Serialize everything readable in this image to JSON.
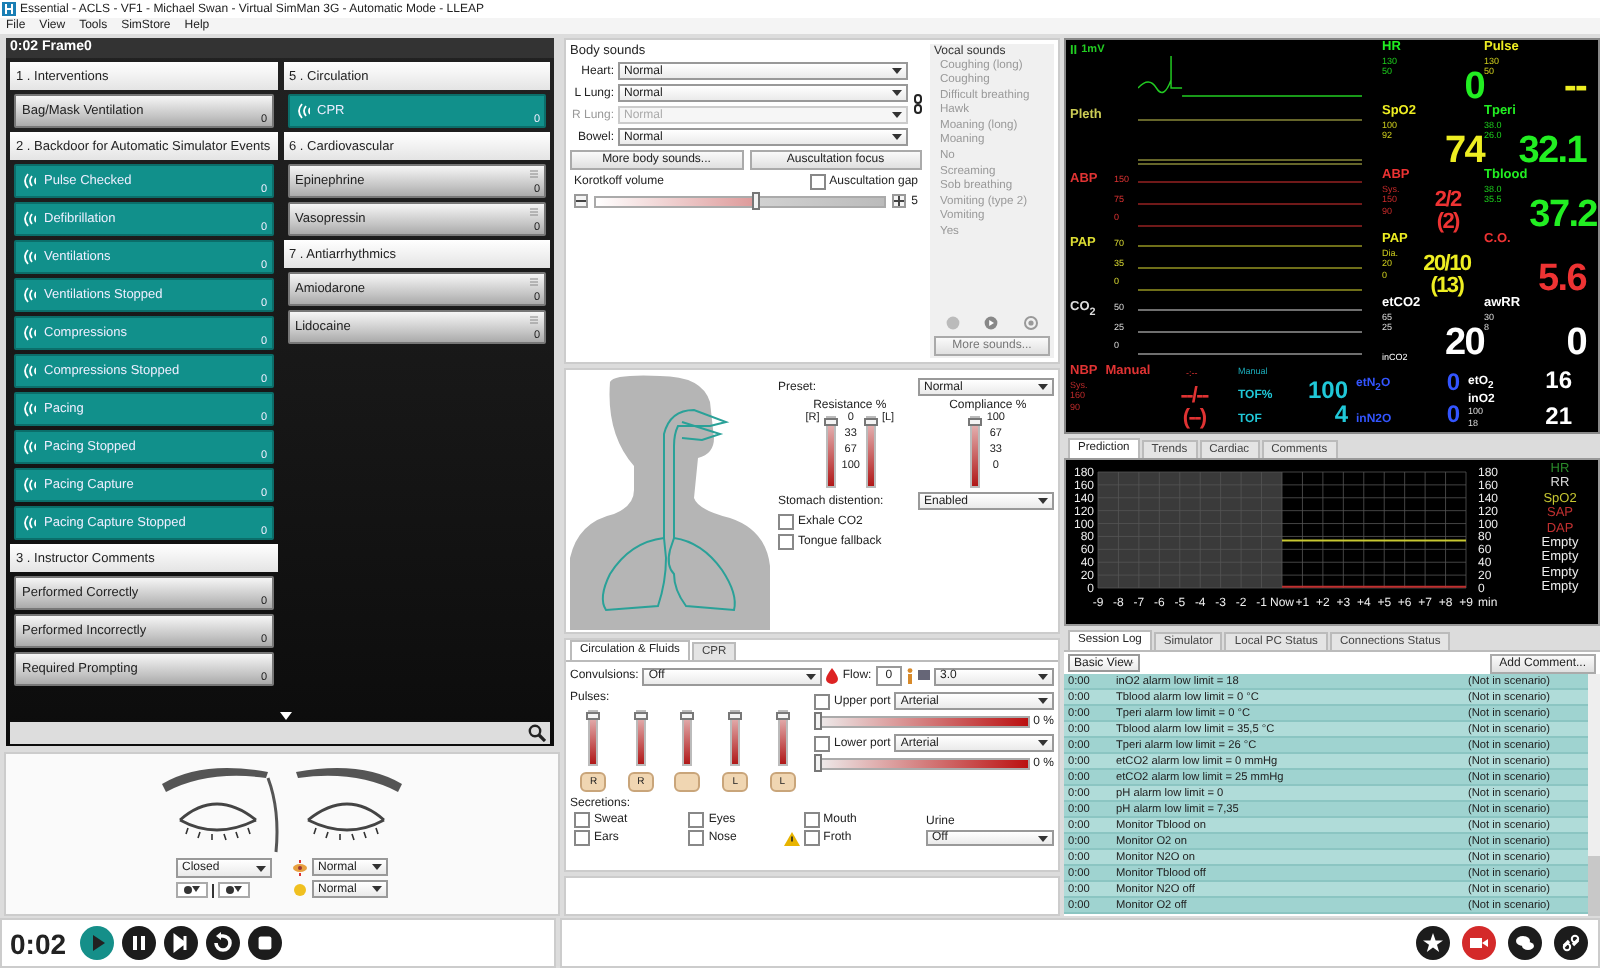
{
  "window": {
    "title": "Essential - ACLS - VF1 - Michael Swan - Virtual SimMan 3G - Automatic Mode - LLEAP"
  },
  "menu": [
    "File",
    "View",
    "Tools",
    "SimStore",
    "Help"
  ],
  "events_panel": {
    "header": "0:02 Frame0",
    "columns": [
      [
        {
          "title": "1 . Interventions",
          "items": [
            {
              "label": "Bag/Mask Ventilation",
              "count": "0",
              "kind": "button"
            }
          ]
        },
        {
          "title": "2 . Backdoor for Automatic Simulator Events",
          "items": [
            {
              "label": "Pulse Checked",
              "count": "0",
              "kind": "event"
            },
            {
              "label": "Defibrillation",
              "count": "0",
              "kind": "event"
            },
            {
              "label": "Ventilations",
              "count": "0",
              "kind": "event"
            },
            {
              "label": "Ventilations Stopped",
              "count": "0",
              "kind": "event"
            },
            {
              "label": "Compressions",
              "count": "0",
              "kind": "event"
            },
            {
              "label": "Compressions Stopped",
              "count": "0",
              "kind": "event"
            },
            {
              "label": "Pacing",
              "count": "0",
              "kind": "event"
            },
            {
              "label": "Pacing Stopped",
              "count": "0",
              "kind": "event"
            },
            {
              "label": "Pacing Capture",
              "count": "0",
              "kind": "event"
            },
            {
              "label": "Pacing Capture Stopped",
              "count": "0",
              "kind": "event"
            }
          ]
        },
        {
          "title": "3 . Instructor Comments",
          "items": [
            {
              "label": "Performed Correctly",
              "count": "0",
              "kind": "button"
            },
            {
              "label": "Performed Incorrectly",
              "count": "0",
              "kind": "button"
            },
            {
              "label": "Required Prompting",
              "count": "0",
              "kind": "button"
            }
          ]
        }
      ],
      [
        {
          "title": "5 . Circulation",
          "items": [
            {
              "label": "CPR",
              "count": "0",
              "kind": "event"
            }
          ]
        },
        {
          "title": "6 . Cardiovascular",
          "items": [
            {
              "label": "Epinephrine",
              "count": "0",
              "kind": "drug"
            },
            {
              "label": "Vasopressin",
              "count": "0",
              "kind": "drug"
            }
          ]
        },
        {
          "title": "7 . Antiarrhythmics",
          "items": [
            {
              "label": "Amiodarone",
              "count": "0",
              "kind": "drug"
            },
            {
              "label": "Lidocaine",
              "count": "0",
              "kind": "drug"
            }
          ]
        }
      ]
    ]
  },
  "eyes": {
    "lids": "Closed",
    "selects": [
      "Normal",
      "Normal"
    ]
  },
  "playback": {
    "time": "0:02"
  },
  "body_sounds": {
    "title": "Body sounds",
    "rows": [
      {
        "label": "Heart:",
        "value": "Normal",
        "disabled": false
      },
      {
        "label": "L Lung:",
        "value": "Normal",
        "disabled": false
      },
      {
        "label": "R Lung:",
        "value": "Normal",
        "disabled": true
      },
      {
        "label": "Bowel:",
        "value": "Normal",
        "disabled": false
      }
    ],
    "buttons": [
      "More body sounds...",
      "Auscultation focus"
    ],
    "korotkoff": {
      "label": "Korotkoff volume",
      "level": 0.56,
      "reading": "5"
    },
    "gap": {
      "label": "Auscultation gap",
      "checked": false
    }
  },
  "vocal_sounds": {
    "title": "Vocal sounds",
    "items": [
      "Coughing (long)",
      "Coughing",
      "Difficult breathing",
      "Hawk",
      "Moaning (long)",
      "Moaning",
      "No",
      "Screaming",
      "Sob breathing",
      "Vomiting (type 2)",
      "Vomiting",
      "Yes"
    ],
    "button": "More sounds..."
  },
  "airway": {
    "preset_label": "Preset:",
    "preset": "Normal",
    "resistance": {
      "title": "Resistance %",
      "left": "[R]",
      "right": "[L]",
      "ticks": [
        "0",
        "33",
        "67",
        "100"
      ],
      "sliders": [
        {
          "level": 1
        },
        {
          "level": 1
        }
      ]
    },
    "compliance": {
      "title": "Compliance %",
      "ticks": [
        "100",
        "67",
        "33",
        "0"
      ],
      "level": 1
    },
    "stomach_label": "Stomach distention:",
    "stomach": "Enabled",
    "checks": [
      {
        "label": "Exhale CO2",
        "checked": false
      },
      {
        "label": "Tongue fallback",
        "checked": false
      }
    ]
  },
  "circulation": {
    "tabs": [
      {
        "label": "Circulation & Fluids",
        "selected": true
      },
      {
        "label": "CPR",
        "selected": false
      }
    ],
    "convulsions_label": "Convulsions:",
    "convulsions": "Off",
    "flow_label": "Flow:",
    "flow": "0",
    "rate": "3.0",
    "pulses_label": "Pulses:",
    "pulses": [
      {
        "letter": "R",
        "level": 1
      },
      {
        "letter": "R",
        "level": 1
      },
      {
        "level": 1
      },
      {
        "letter": "L",
        "level": 1
      },
      {
        "letter": "L",
        "level": 1
      }
    ],
    "ports": [
      {
        "label": "Upper port",
        "checked": false,
        "value": "Arterial",
        "level": 0,
        "reading": "0 %"
      },
      {
        "label": "Lower port",
        "checked": false,
        "value": "Arterial",
        "level": 0,
        "reading": "0 %"
      }
    ],
    "secretions_label": "Secretions:",
    "secretions": [
      {
        "label": "Sweat",
        "checked": false
      },
      {
        "label": "Eyes",
        "checked": false
      },
      {
        "label": "Mouth",
        "checked": false
      },
      {
        "label": "Ears",
        "checked": false
      },
      {
        "label": "Nose",
        "checked": false
      },
      {
        "label": "Froth",
        "checked": false,
        "warning": true
      }
    ],
    "urine_label": "Urine",
    "urine": "Off"
  },
  "monitor": {
    "rows": [
      {
        "wave": {
          "label": "II",
          "scale": "1mV",
          "color": "#22cc22"
        },
        "params": [
          {
            "name": "HR",
            "limits": [
              "130",
              "50"
            ],
            "value": "0",
            "color": "#22ee22"
          },
          {
            "name": "Pulse",
            "limits": [
              "130",
              "50"
            ],
            "value": "--",
            "color": "#eeee22"
          }
        ]
      },
      {
        "wave": {
          "label": "Pleth",
          "color": "#cccc55"
        },
        "params": [
          {
            "name": "SpO2",
            "limits": [
              "100",
              "92"
            ],
            "value": "74",
            "color": "#eeee22"
          },
          {
            "name": "Tperi",
            "limits": [
              "38.0",
              "26.0"
            ],
            "value": "32.1",
            "color": "#22ee22"
          }
        ]
      },
      {
        "wave": {
          "label": "ABP",
          "color": "#e03333",
          "ticks": [
            "150",
            "75",
            "0"
          ]
        },
        "params": [
          {
            "name": "ABP",
            "sub": "Sys.",
            "limits": [
              "150",
              "90"
            ],
            "value": "2/2",
            "value2": "(2)",
            "color": "#ee3333"
          },
          {
            "name": "Tblood",
            "limits": [
              "38.0",
              "35.5"
            ],
            "value": "37.2",
            "color": "#22ee22"
          }
        ]
      },
      {
        "wave": {
          "label": "PAP",
          "color": "#dddd33",
          "ticks": [
            "70",
            "35",
            "0"
          ]
        },
        "params": [
          {
            "name": "PAP",
            "sub": "Dia.",
            "limits": [
              "20",
              "0"
            ],
            "value": "20/10",
            "value2": "(13)",
            "color": "#eeee22"
          },
          {
            "name": "C.O.",
            "value": "5.6",
            "color": "#ee3333"
          }
        ]
      },
      {
        "wave": {
          "label": "CO$_{2}$",
          "color": "#dddddd",
          "ticks": [
            "50",
            "25",
            "0"
          ]
        },
        "params": [
          {
            "name": "etCO2",
            "limits": [
              "65",
              "25"
            ],
            "value": "20",
            "color": "#ffffff",
            "footer": "inCO2"
          },
          {
            "name": "awRR",
            "limits": [
              "30",
              "8"
            ],
            "value": "0",
            "color": "#ffffff"
          }
        ]
      }
    ],
    "nbp": {
      "name": "NBP",
      "mode": "Manual",
      "time": "-:--",
      "sub": "Sys.",
      "limits": [
        "160",
        "90"
      ],
      "value": "--/--",
      "value2": "(--)"
    },
    "tof": {
      "mode": "Manual",
      "items": [
        {
          "label": "TOF%",
          "value": "100"
        },
        {
          "label": "TOF",
          "value": "4"
        }
      ]
    },
    "gases": [
      {
        "label": "etN$_{2}$O",
        "value": "0",
        "color": "#3355ff"
      },
      {
        "label": "inN2O",
        "value": "0",
        "color": "#3355ff"
      }
    ],
    "oxygen": [
      {
        "label": "etO$_{2}$",
        "value": "16",
        "color": "#ffffff"
      },
      {
        "label": "inO2",
        "limits": [
          "100",
          "18"
        ],
        "value": "21",
        "color": "#ffffff"
      }
    ]
  },
  "prediction": {
    "tabs": [
      {
        "label": "Prediction",
        "selected": true
      },
      {
        "label": "Trends",
        "selected": false
      },
      {
        "label": "Cardiac",
        "selected": false
      },
      {
        "label": "Comments",
        "selected": false
      }
    ],
    "chart_data": {
      "type": "line",
      "xlabel": "min",
      "categories": [
        "-9",
        "-8",
        "-7",
        "-6",
        "-5",
        "-4",
        "-3",
        "-2",
        "-1",
        "Now",
        "+1",
        "+2",
        "+3",
        "+4",
        "+5",
        "+6",
        "+7",
        "+8",
        "+9"
      ],
      "grid": true,
      "ylim": [
        0,
        180
      ],
      "yticks": [
        0,
        20,
        40,
        60,
        80,
        100,
        120,
        140,
        160,
        180
      ],
      "series": [
        {
          "name": "HR",
          "color": "#2a8a2a",
          "values": [
            null,
            null,
            null,
            null,
            null,
            null,
            null,
            null,
            null,
            null,
            null,
            null,
            null,
            null,
            null,
            null,
            null,
            null,
            null
          ]
        },
        {
          "name": "RR",
          "color": "#dddddd",
          "values": [
            null,
            null,
            null,
            null,
            null,
            null,
            null,
            null,
            null,
            null,
            null,
            null,
            null,
            null,
            null,
            null,
            null,
            null,
            null
          ]
        },
        {
          "name": "SpO2",
          "color": "#c8c832",
          "values": [
            null,
            null,
            null,
            null,
            null,
            null,
            null,
            null,
            null,
            74,
            74,
            74,
            74,
            74,
            74,
            74,
            74,
            74,
            74
          ]
        },
        {
          "name": "SAP",
          "color": "#c03030",
          "values": [
            null,
            null,
            null,
            null,
            null,
            null,
            null,
            null,
            null,
            2,
            2,
            2,
            2,
            2,
            2,
            2,
            2,
            2,
            2
          ]
        },
        {
          "name": "DAP",
          "color": "#c03030",
          "values": [
            null,
            null,
            null,
            null,
            null,
            null,
            null,
            null,
            null,
            null,
            null,
            null,
            null,
            null,
            null,
            null,
            null,
            null,
            null
          ]
        },
        {
          "name": "Empty",
          "color": "#eeeeee",
          "values": [
            null,
            null,
            null,
            null,
            null,
            null,
            null,
            null,
            null,
            null,
            null,
            null,
            null,
            null,
            null,
            null,
            null,
            null,
            null
          ]
        },
        {
          "name": "Empty",
          "color": "#eeeeee",
          "values": [
            null,
            null,
            null,
            null,
            null,
            null,
            null,
            null,
            null,
            null,
            null,
            null,
            null,
            null,
            null,
            null,
            null,
            null,
            null
          ]
        },
        {
          "name": "Empty",
          "color": "#eeeeee",
          "values": [
            null,
            null,
            null,
            null,
            null,
            null,
            null,
            null,
            null,
            null,
            null,
            null,
            null,
            null,
            null,
            null,
            null,
            null,
            null
          ]
        },
        {
          "name": "Empty",
          "color": "#eeeeee",
          "values": [
            null,
            null,
            null,
            null,
            null,
            null,
            null,
            null,
            null,
            null,
            null,
            null,
            null,
            null,
            null,
            null,
            null,
            null,
            null
          ]
        }
      ]
    },
    "right_yticks": [
      "180",
      "160",
      "140",
      "120",
      "100",
      "80",
      "60",
      "40",
      "20",
      "0"
    ]
  },
  "session": {
    "tabs": [
      {
        "label": "Session Log",
        "selected": true
      },
      {
        "label": "Simulator",
        "selected": false
      },
      {
        "label": "Local PC Status",
        "selected": false
      },
      {
        "label": "Connections Status",
        "selected": false
      }
    ],
    "view": "Basic View",
    "add_button": "Add Comment...",
    "rows": [
      {
        "time": "0:00",
        "event": "inO2 alarm low limit = 18",
        "status": "(Not in scenario)"
      },
      {
        "time": "0:00",
        "event": "Tblood alarm low limit = 0 °C",
        "status": "(Not in scenario)"
      },
      {
        "time": "0:00",
        "event": "Tperi alarm low limit = 0 °C",
        "status": "(Not in scenario)"
      },
      {
        "time": "0:00",
        "event": "Tblood alarm low limit = 35,5 °C",
        "status": "(Not in scenario)"
      },
      {
        "time": "0:00",
        "event": "Tperi alarm low limit = 26 °C",
        "status": "(Not in scenario)"
      },
      {
        "time": "0:00",
        "event": "etCO2 alarm low limit = 0 mmHg",
        "status": "(Not in scenario)"
      },
      {
        "time": "0:00",
        "event": "etCO2 alarm low limit = 25 mmHg",
        "status": "(Not in scenario)"
      },
      {
        "time": "0:00",
        "event": "pH alarm low limit = 0",
        "status": "(Not in scenario)"
      },
      {
        "time": "0:00",
        "event": "pH alarm low limit = 7,35",
        "status": "(Not in scenario)"
      },
      {
        "time": "0:00",
        "event": "Monitor Tblood on",
        "status": "(Not in scenario)"
      },
      {
        "time": "0:00",
        "event": "Monitor O2 on",
        "status": "(Not in scenario)"
      },
      {
        "time": "0:00",
        "event": "Monitor N2O on",
        "status": "(Not in scenario)"
      },
      {
        "time": "0:00",
        "event": "Monitor Tblood off",
        "status": "(Not in scenario)"
      },
      {
        "time": "0:00",
        "event": "Monitor N2O off",
        "status": "(Not in scenario)"
      },
      {
        "time": "0:00",
        "event": "Monitor O2 off",
        "status": "(Not in scenario)"
      }
    ]
  }
}
